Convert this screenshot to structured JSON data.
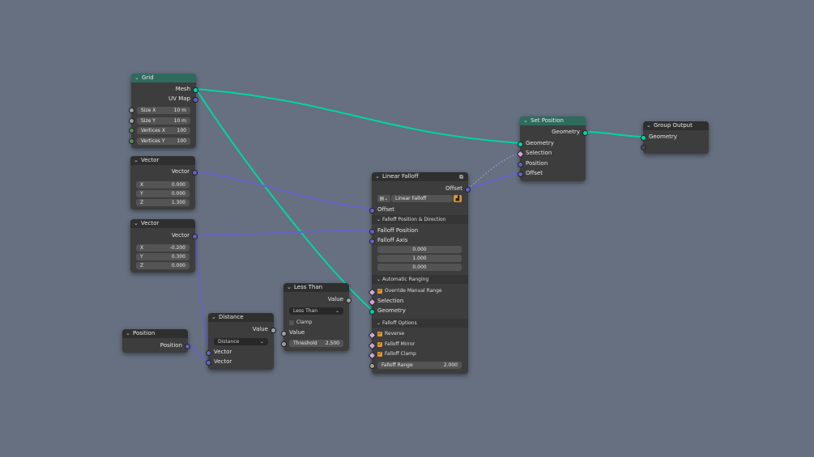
{
  "nodes": {
    "grid": {
      "title": "Grid",
      "outputs": [
        "Mesh",
        "UV Map"
      ],
      "fields": [
        {
          "label": "Size X",
          "value": "10 m"
        },
        {
          "label": "Size Y",
          "value": "10 m"
        },
        {
          "label": "Vertices X",
          "value": "100"
        },
        {
          "label": "Vertices Y",
          "value": "100"
        }
      ]
    },
    "vector1": {
      "title": "Vector",
      "output": "Vector",
      "fields": [
        {
          "label": "X",
          "value": "0.000"
        },
        {
          "label": "Y",
          "value": "0.000"
        },
        {
          "label": "Z",
          "value": "1.300"
        }
      ]
    },
    "vector2": {
      "title": "Vector",
      "output": "Vector",
      "fields": [
        {
          "label": "X",
          "value": "-0.200"
        },
        {
          "label": "Y",
          "value": "0.300"
        },
        {
          "label": "Z",
          "value": "0.000"
        }
      ]
    },
    "position": {
      "title": "Position",
      "output": "Position"
    },
    "distance": {
      "title": "Distance",
      "output": "Value",
      "mode": "Distance",
      "inputs": [
        "Vector",
        "Vector"
      ]
    },
    "less_than": {
      "title": "Less Than",
      "output": "Value",
      "mode": "Less Than",
      "clamp_label": "Clamp",
      "input": "Value",
      "threshold_label": "Threshold",
      "threshold_value": "2.500"
    },
    "linear_falloff": {
      "title": "Linear Falloff",
      "output": "Offset",
      "group_name": "Linear Falloff",
      "input_offset": "Offset",
      "section_position": "Falloff Position & Direction",
      "falloff_position": "Falloff Position",
      "falloff_axis": "Falloff Axis",
      "axis_values": [
        "0.000",
        "1.000",
        "0.000"
      ],
      "section_ranging": "Automatic Ranging",
      "override": "Override Manual Range",
      "selection": "Selection",
      "geometry": "Geometry",
      "section_options": "Falloff Options",
      "reverse": "Reverse",
      "mirror": "Falloff Mirror",
      "clamp": "Falloff Clamp",
      "range_label": "Falloff Range",
      "range_value": "2.000"
    },
    "set_position": {
      "title": "Set Position",
      "output": "Geometry",
      "inputs": [
        "Geometry",
        "Selection",
        "Position",
        "Offset"
      ]
    },
    "group_output": {
      "title": "Group Output",
      "input": "Geometry"
    }
  },
  "colors": {
    "background": "#667080",
    "geometry_socket": "#00d6a3",
    "vector_socket": "#6363c7",
    "float_socket": "#a1a1a1",
    "geometry_node_header": "#2e6b5c",
    "checkbox": "#e2962f"
  }
}
